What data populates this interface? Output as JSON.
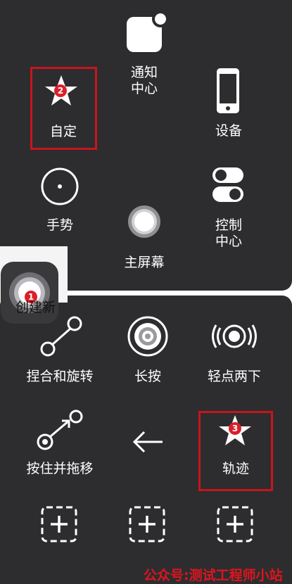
{
  "top_menu": {
    "notification_center": "通知\n中心",
    "custom": "自定",
    "device": "设备",
    "gestures": "手势",
    "home_screen": "主屏幕",
    "control_center": "控制\n中心"
  },
  "custom_menu": {
    "pinch_rotate": "捏合和旋转",
    "long_press": "长按",
    "double_tap": "轻点两下",
    "hold_drag": "按住并拖移",
    "trajectory": "轨迹"
  },
  "floating_button": {
    "badge": "1",
    "caption": "创建新"
  },
  "badges": {
    "custom": "2",
    "trajectory": "3"
  },
  "watermark": "公众号:测试工程师小站",
  "colors": {
    "panel": "#2d2d2f",
    "highlight": "#c8141c",
    "badge": "#d9202a",
    "watermark": "#e0141e"
  }
}
